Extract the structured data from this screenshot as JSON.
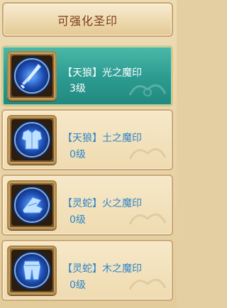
{
  "header": {
    "title": "可强化圣印"
  },
  "seals": [
    {
      "name": "【天狼】光之魔印",
      "level": "3级",
      "icon": "sword-icon",
      "selected": true
    },
    {
      "name": "【天狼】土之魔印",
      "level": "0级",
      "icon": "armor-icon",
      "selected": false
    },
    {
      "name": "【灵蛇】火之魔印",
      "level": "0级",
      "icon": "boots-icon",
      "selected": false
    },
    {
      "name": "【灵蛇】木之魔印",
      "level": "0级",
      "icon": "leggings-icon",
      "selected": false
    }
  ],
  "colors": {
    "selected_bg": "#2d9c92",
    "name_blue": "#2f84c6",
    "title_brown": "#7a3c16",
    "panel_tan": "#e4cfa2"
  }
}
